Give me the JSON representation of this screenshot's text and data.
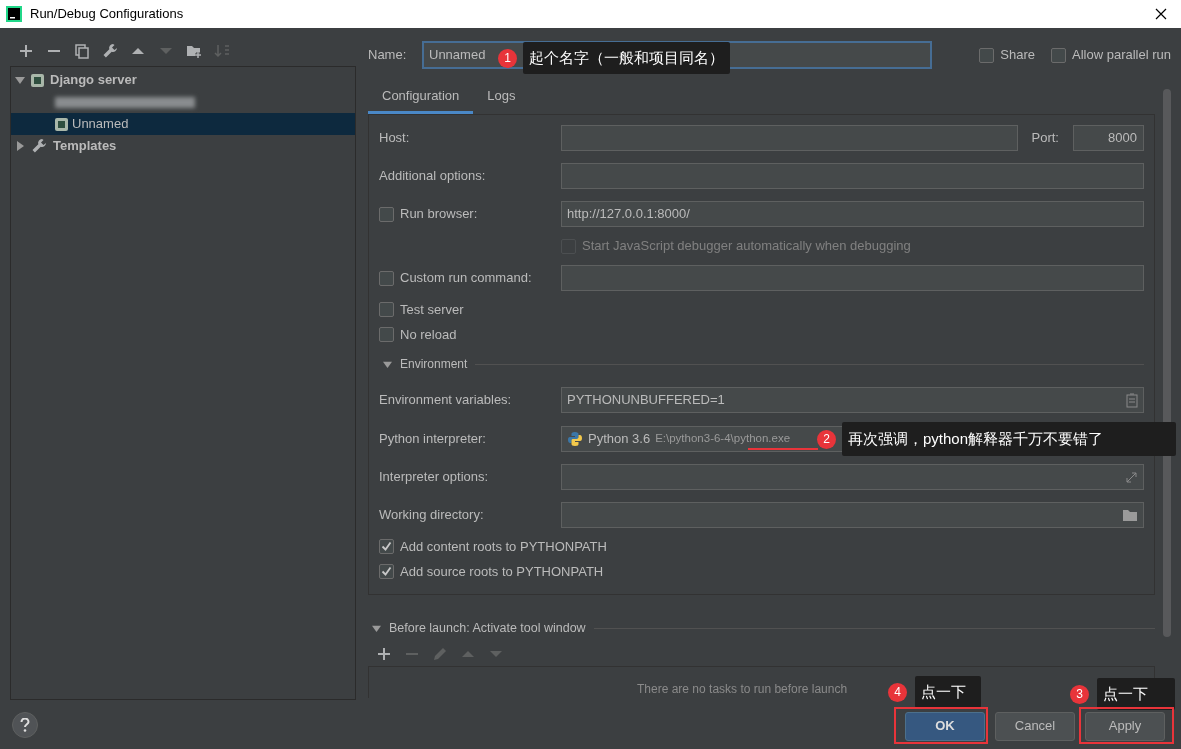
{
  "window": {
    "title": "Run/Debug Configurations"
  },
  "toolbar": [
    {
      "kind": "add",
      "disabled": false
    },
    {
      "kind": "remove",
      "disabled": false
    },
    {
      "kind": "copy",
      "disabled": false
    },
    {
      "kind": "wrench",
      "disabled": false
    },
    {
      "kind": "up",
      "disabled": false
    },
    {
      "kind": "down",
      "disabled": true
    },
    {
      "kind": "folder",
      "disabled": false
    },
    {
      "kind": "sort",
      "disabled": true
    }
  ],
  "tree": [
    {
      "label": "Django server",
      "expanded": true,
      "selected": false,
      "children": [
        {
          "kind": "blurred",
          "selected": false
        },
        {
          "kind": "item",
          "label": "Unnamed",
          "selected": true
        }
      ]
    },
    {
      "label": "Templates",
      "expanded": false,
      "selected": false
    }
  ],
  "name_field": {
    "label": "Name:",
    "value": "Unnamed"
  },
  "options": [
    {
      "label": "Share",
      "checked": false
    },
    {
      "label": "Allow parallel run",
      "checked": false
    }
  ],
  "tabs": [
    {
      "label": "Configuration",
      "selected": true
    },
    {
      "label": "Logs",
      "selected": false
    }
  ],
  "form": [
    {
      "kind": "host",
      "label": "Host:",
      "port_label": "Port:",
      "port": "8000"
    },
    {
      "kind": "field",
      "label": "Additional options:"
    },
    {
      "kind": "checkfield",
      "label": "Run browser:",
      "checked": false,
      "value": "http://127.0.0.1:8000/"
    },
    {
      "kind": "subcheck",
      "label": "Start JavaScript debugger automatically when debugging",
      "checked": false,
      "disabled": true
    },
    {
      "kind": "checkfield",
      "label": "Custom run command:",
      "checked": false
    },
    {
      "kind": "check",
      "label": "Test server",
      "checked": false
    },
    {
      "kind": "check",
      "label": "No reload",
      "checked": false
    }
  ],
  "environment": {
    "label": "Environment",
    "expanded": true
  },
  "env_rows": [
    {
      "kind": "field",
      "label": "Environment variables:",
      "value": "PYTHONUNBUFFERED=1"
    },
    {
      "kind": "interpreter",
      "label": "Python interpreter:",
      "version": "Python 3.6",
      "path": "E:\\python3-6-4\\",
      "file": "python.exe"
    },
    {
      "kind": "field",
      "label": "Interpreter options:"
    },
    {
      "kind": "field",
      "label": "Working directory:"
    },
    {
      "kind": "check",
      "label": "Add content roots to PYTHONPATH",
      "checked": true
    },
    {
      "kind": "check",
      "label": "Add source roots to PYTHONPATH",
      "checked": true
    }
  ],
  "before_launch": {
    "label": "Before launch: Activate tool window",
    "expanded": true,
    "toolbar": [
      {
        "kind": "add",
        "disabled": false
      },
      {
        "kind": "remove",
        "disabled": true
      },
      {
        "kind": "edit",
        "disabled": true
      },
      {
        "kind": "up",
        "disabled": true
      },
      {
        "kind": "down",
        "disabled": true
      }
    ],
    "empty_text": "There are no tasks to run before launch"
  },
  "buttons": [
    {
      "label": "OK",
      "default": true
    },
    {
      "label": "Cancel",
      "default": false
    },
    {
      "label": "Apply",
      "default": false
    }
  ],
  "annotations": [
    {
      "number": "1",
      "text": "起个名字（一般和项目同名）"
    },
    {
      "number": "2",
      "text": "再次强调，python解释器千万不要错了"
    },
    {
      "number": "4",
      "text": "点一下"
    },
    {
      "number": "3",
      "text": "点一下"
    }
  ]
}
